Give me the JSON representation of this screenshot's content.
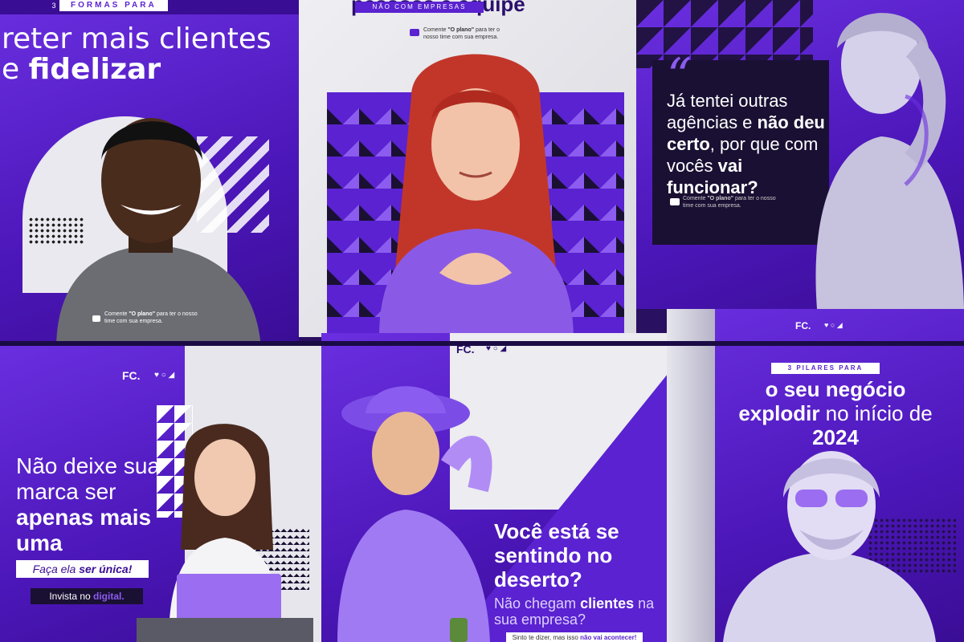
{
  "post1": {
    "tag_number": "3",
    "tag": "FORMAS PARA",
    "headline_regular": "reter mais clientes",
    "headline_connector": "e ",
    "headline_bold": "fidelizar",
    "cta_prefix": "Comente ",
    "cta_bold": "\"O plano\"",
    "cta_suffix": " para ter o nosso time com sua empresa."
  },
  "post2": {
    "title": "pessoas e equipe",
    "subtitle": "NÃO COM EMPRESAS",
    "cta_prefix": "Comente ",
    "cta_bold": "\"O plano\"",
    "cta_suffix": " para ter o nosso time com sua empresa."
  },
  "post3": {
    "quote_mark": "“",
    "text_1": "Já tentei outras agências e ",
    "text_bold_1": "não deu certo",
    "text_2": ", por que com vocês ",
    "text_bold_2": "vai funcionar?",
    "cta_prefix": "Comente ",
    "cta_bold": "\"O plano\"",
    "cta_suffix": " para ter o nosso time com sua empresa."
  },
  "post4": {
    "logo": "FC.",
    "icons": "♥ ○ ◢",
    "headline_regular": "Não deixe sua marca ser ",
    "headline_bold": "apenas mais uma",
    "pill1_regular": "Faça ela ",
    "pill1_bold": "ser única!",
    "pill2_regular": "Invista no ",
    "pill2_bold": "digital."
  },
  "post5": {
    "logo": "FC.",
    "icons": "♥ ○ ◢",
    "headline": "Você está se sentindo no deserto?",
    "sub_regular_1": "Não chegam ",
    "sub_bold": "clientes",
    "sub_regular_2": " na sua empresa?",
    "foot_regular": "Sinto te dizer, mas isso ",
    "foot_bold": "não vai acontecer!"
  },
  "post6": {
    "logo": "FC.",
    "icons": "♥ ○ ◢",
    "tag": "3 PILARES PARA",
    "headline_bold_1": "o seu negócio",
    "headline_bold_2": "explodir",
    "headline_regular": " no início de ",
    "headline_bold_3": "2024"
  },
  "colors": {
    "brand_purple": "#5a22d0",
    "deep_purple": "#2a0f6b",
    "accent_lilac": "#8c5cf0",
    "near_black": "#1a1033"
  }
}
